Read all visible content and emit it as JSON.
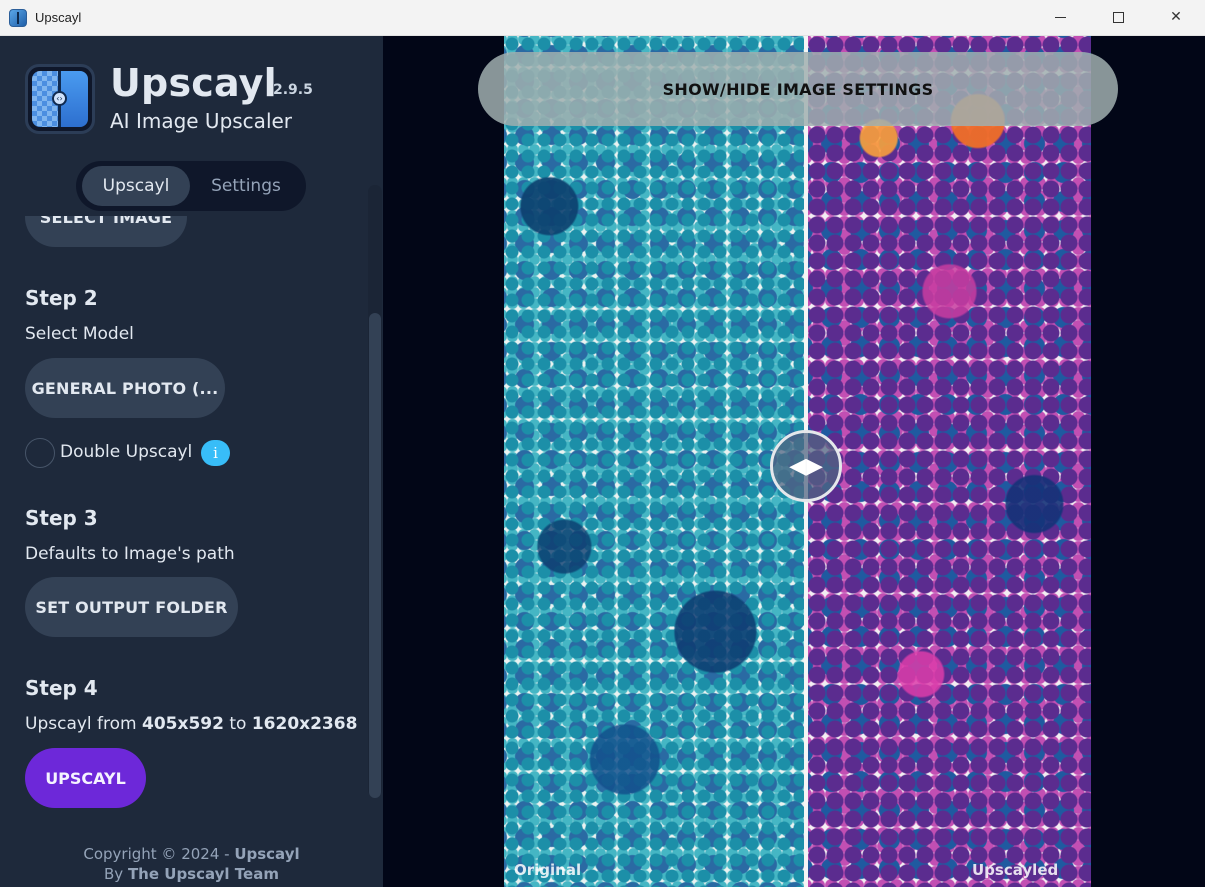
{
  "window": {
    "title": "Upscayl"
  },
  "sidebar": {
    "app_name": "Upscayl",
    "version": "2.9.5",
    "subtitle": "AI Image Upscaler",
    "tabs": [
      {
        "label": "Upscayl",
        "active": true
      },
      {
        "label": "Settings",
        "active": false
      }
    ],
    "step1": {
      "button": "SELECT IMAGE"
    },
    "step2": {
      "title": "Step 2",
      "desc": "Select Model",
      "model_button": "GENERAL PHOTO (...",
      "double_label": "Double Upscayl",
      "info_icon": "i"
    },
    "step3": {
      "title": "Step 3",
      "desc": "Defaults to Image's path",
      "button": "SET OUTPUT FOLDER"
    },
    "step4": {
      "title": "Step 4",
      "desc_prefix": "Upscayl from ",
      "from_size": "405x592",
      "desc_mid": " to ",
      "to_size": "1620x2368",
      "button": "UPSCAYL"
    },
    "copyright_line1": "Copyright © 2024 - ",
    "copyright_brand": "Upscayl",
    "copyright_by": "By ",
    "copyright_team": "The Upscayl Team"
  },
  "main": {
    "settings_toggle": "SHOW/HIDE IMAGE SETTINGS",
    "label_original": "Original",
    "label_upscayled": "Upscayled"
  },
  "colors": {
    "accent": "#6d28d9",
    "info": "#38bdf8",
    "sidebar_bg": "#1e293b",
    "main_bg": "#020617"
  }
}
